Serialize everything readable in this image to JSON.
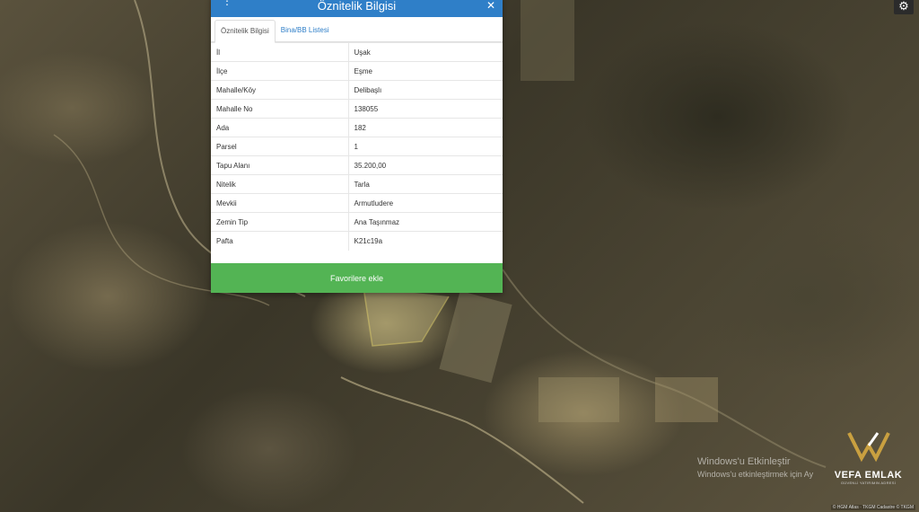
{
  "panel": {
    "title": "Öznitelik Bilgisi",
    "tabs": [
      {
        "label": "Öznitelik Bilgisi",
        "active": true
      },
      {
        "label": "Bina/BB Listesi",
        "active": false
      }
    ],
    "rows": [
      {
        "key": "İl",
        "value": "Uşak"
      },
      {
        "key": "İlçe",
        "value": "Eşme"
      },
      {
        "key": "Mahalle/Köy",
        "value": "Delibaşlı"
      },
      {
        "key": "Mahalle No",
        "value": "138055"
      },
      {
        "key": "Ada",
        "value": "182"
      },
      {
        "key": "Parsel",
        "value": "1"
      },
      {
        "key": "Tapu Alanı",
        "value": "35.200,00"
      },
      {
        "key": "Nitelik",
        "value": "Tarla"
      },
      {
        "key": "Mevkii",
        "value": "Armutludere"
      },
      {
        "key": "Zemin Tip",
        "value": "Ana Taşınmaz"
      },
      {
        "key": "Pafta",
        "value": "K21c19a"
      }
    ],
    "favorite_label": "Favorilere ekle"
  },
  "watermark": {
    "line1": "Windows'u Etkinleştir",
    "line2": "Windows'u etkinleştirmek için Ay"
  },
  "logo": {
    "name": "VEFA EMLAK",
    "slogan": "GÜVENLİ YATIRIMIN ADRESİ"
  },
  "attribution": "© HGM Atlas · TKGM Cadastre © TKGM",
  "colors": {
    "header": "#2f7fc8",
    "button": "#53b454"
  },
  "icons": {
    "menu": "menu-icon",
    "close": "close-icon",
    "settings": "gear-icon"
  }
}
